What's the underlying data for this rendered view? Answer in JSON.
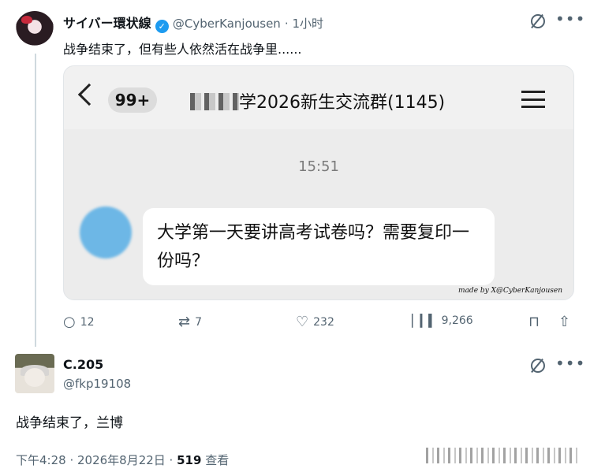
{
  "post": {
    "author_name": "サイバー環状線",
    "author_handle": "@CyberKanjousen",
    "time_ago": "· 1小时",
    "text": "战争结束了，但有些人依然活在战争里......",
    "media": {
      "unread_badge": "99+",
      "group_title": "学2026新生交流群(1145)",
      "time": "15:51",
      "message": "大学第一天要讲高考试卷吗？需要复印一份吗？",
      "watermark": "made by X@CyberKanjousen"
    },
    "actions": {
      "replies": "12",
      "reposts": "7",
      "likes": "232",
      "views": "9,266"
    }
  },
  "reply": {
    "author_name": "C.205",
    "author_handle": "@fkp19108",
    "text": "战争结束了，兰博",
    "timestamp": "下午4:28 · 2026年8月22日 · ",
    "views_count": "519",
    "views_label": " 查看"
  },
  "icons": {
    "verified": "verified-badge-icon",
    "more": "more-icon",
    "grok": "grok-icon",
    "reply": "reply-icon",
    "repost": "repost-icon",
    "like": "heart-icon",
    "views": "views-icon",
    "bookmark": "bookmark-icon",
    "share": "share-icon"
  },
  "colors": {
    "accent": "#1d9bf0",
    "secondary_text": "#536471"
  }
}
